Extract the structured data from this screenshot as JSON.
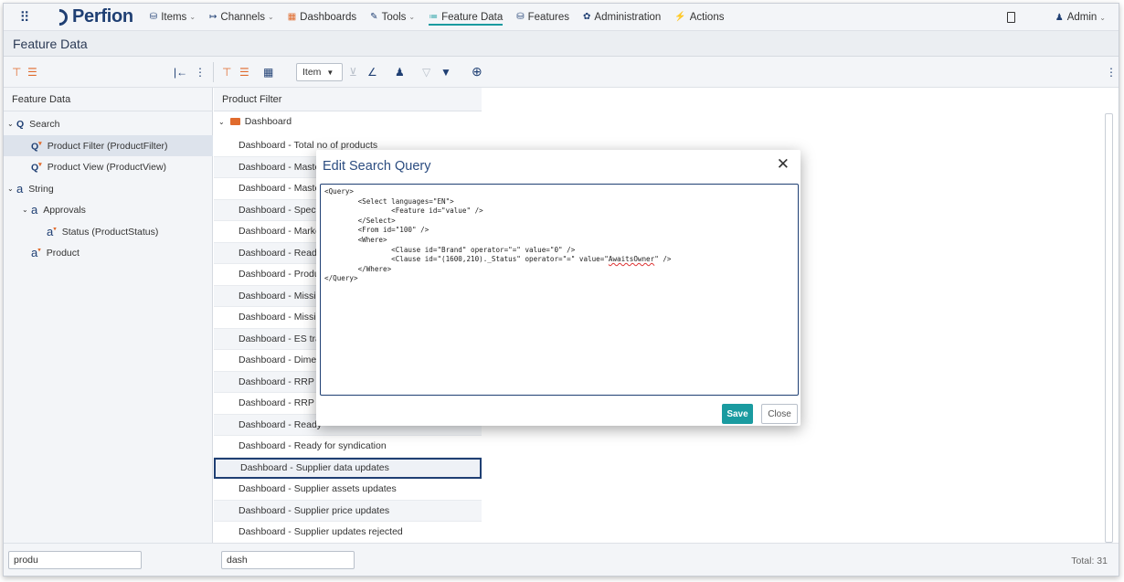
{
  "nav": {
    "logo_text": "Perfion",
    "items": [
      {
        "label": "Items",
        "icon": "items-icon",
        "dropdown": true
      },
      {
        "label": "Channels",
        "icon": "channels-icon",
        "dropdown": true
      },
      {
        "label": "Dashboards",
        "icon": "dashboards-icon",
        "dropdown": false
      },
      {
        "label": "Tools",
        "icon": "tools-icon",
        "dropdown": true
      },
      {
        "label": "Feature Data",
        "icon": "feature-data-icon",
        "dropdown": false,
        "active": true
      },
      {
        "label": "Features",
        "icon": "features-icon",
        "dropdown": false
      },
      {
        "label": "Administration",
        "icon": "administration-icon",
        "dropdown": false
      },
      {
        "label": "Actions",
        "icon": "actions-icon",
        "dropdown": false
      }
    ],
    "user": "Admin"
  },
  "page_title": "Feature Data",
  "toolbar": {
    "item_select": "Item"
  },
  "left": {
    "header": "Feature Data",
    "tree": [
      {
        "label": "Search",
        "icon": "Q"
      },
      {
        "label": "Product Filter (ProductFilter)",
        "icon": "Q"
      },
      {
        "label": "Product View (ProductView)",
        "icon": "Q"
      },
      {
        "label": "String",
        "icon": "a"
      },
      {
        "label": "Approvals",
        "icon": "a"
      },
      {
        "label": "Status (ProductStatus)",
        "icon": "a"
      },
      {
        "label": "Product",
        "icon": "a"
      }
    ],
    "search_value": "produ"
  },
  "middle": {
    "header": "Product Filter",
    "folder": "Dashboard",
    "rows": [
      "Dashboard - Total no of products",
      "Dashboard - Maste",
      "Dashboard - Maste",
      "Dashboard - Speci",
      "Dashboard - Marke",
      "Dashboard - Ready",
      "Dashboard - Produ",
      "Dashboard - Missi",
      "Dashboard - Missi",
      "Dashboard - ES tra",
      "Dashboard - Dimen",
      "Dashboard - RRP n",
      "Dashboard - RRP n",
      "Dashboard - Ready",
      "Dashboard - Ready for syndication",
      "Dashboard - Supplier data updates",
      "Dashboard - Supplier assets updates",
      "Dashboard - Supplier price updates",
      "Dashboard - Supplier updates rejected"
    ],
    "search_value": "dash"
  },
  "footer": {
    "total": "Total: 31"
  },
  "modal": {
    "title": "Edit Search Query",
    "query_lines": [
      "<Query>",
      "        <Select languages=\"EN\">",
      "                <Feature id=\"value\" />",
      "        </Select>",
      "        <From id=\"100\" />",
      "        <Where>",
      "                <Clause id=\"Brand\" operator=\"=\" value=\"0\" />",
      "                <Clause id=\"(1600,210)._Status\" operator=\"=\" value=\"",
      "        </Where>",
      "</Query>"
    ],
    "squiggle_word": "AwaitsOwner",
    "line8_tail": "\" />",
    "save_label": "Save",
    "close_label": "Close"
  }
}
